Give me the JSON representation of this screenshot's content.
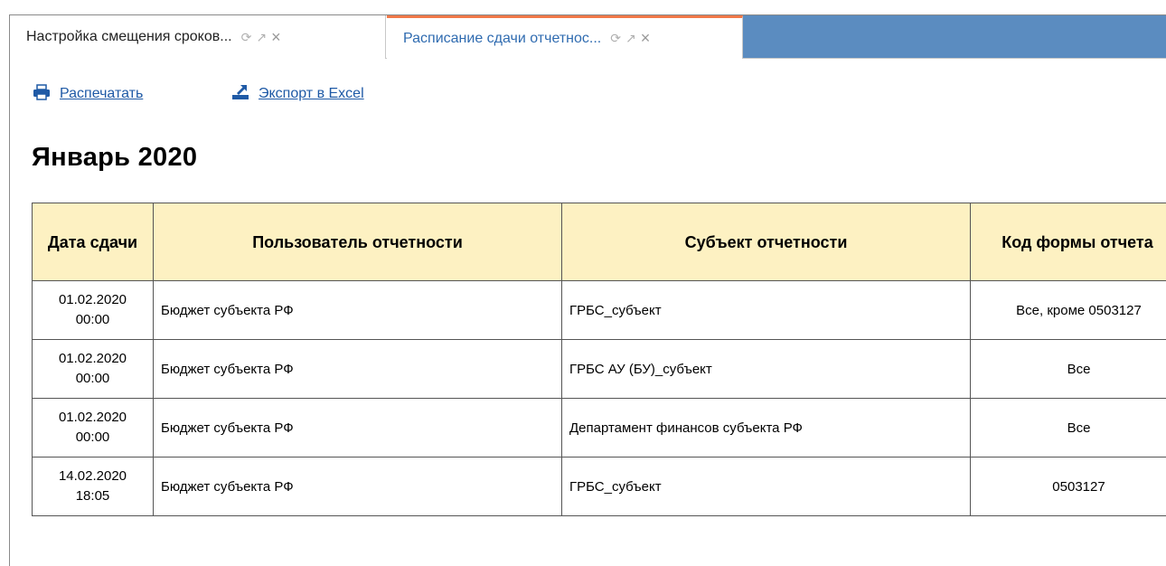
{
  "tabs": [
    {
      "label": "Настройка смещения сроков...",
      "active": false
    },
    {
      "label": "Расписание сдачи отчетнос...",
      "active": true
    }
  ],
  "colors": {
    "active_tab_accent": "#f07848",
    "tabbar_fill": "#5b8cc0",
    "link": "#1f5aa6",
    "header_bg": "#fdf1c2"
  },
  "toolbar": {
    "print_label": "Распечатать",
    "print_icon": "printer-icon",
    "excel_label": "Экспорт в Excel",
    "excel_icon": "excel-export-icon"
  },
  "title": "Январь 2020",
  "table": {
    "headers": {
      "date": "Дата сдачи",
      "user": "Пользователь отчетности",
      "subject": "Субъект отчетности",
      "code": "Код формы отчета"
    },
    "rows": [
      {
        "date": "01.02.2020",
        "time": "00:00",
        "user": "Бюджет субъекта РФ",
        "subject": "ГРБС_субъект",
        "code": "Все, кроме 0503127"
      },
      {
        "date": "01.02.2020",
        "time": "00:00",
        "user": "Бюджет субъекта РФ",
        "subject": "ГРБС АУ (БУ)_субъект",
        "code": "Все"
      },
      {
        "date": "01.02.2020",
        "time": "00:00",
        "user": "Бюджет субъекта РФ",
        "subject": "Департамент финансов субъекта РФ",
        "code": "Все"
      },
      {
        "date": "14.02.2020",
        "time": "18:05",
        "user": "Бюджет субъекта РФ",
        "subject": "ГРБС_субъект",
        "code": "0503127"
      }
    ]
  }
}
